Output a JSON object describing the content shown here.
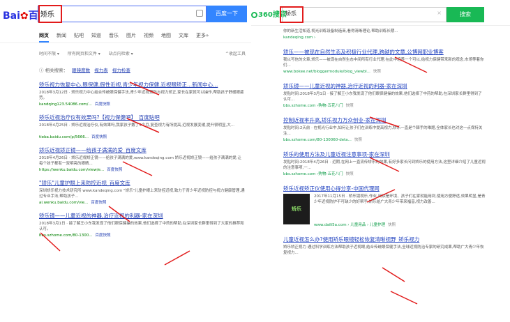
{
  "baidu": {
    "logo": {
      "brand_pre": "Bai",
      "brand_post": "百度"
    },
    "search": {
      "value": "矫乐",
      "button": "百度一下"
    },
    "tabs": [
      "网页",
      "新闻",
      "贴吧",
      "知道",
      "音乐",
      "图片",
      "视频",
      "地图",
      "文库",
      "更多»"
    ],
    "filters": {
      "time": "时间不限 ▾",
      "type": "所有网页和文件 ▾",
      "site": "站点内检索 ▾",
      "collapse": "^收起工具"
    },
    "related": {
      "label": "相关搜索：",
      "links": [
        "眼镜度数",
        "视力表",
        "视力检查"
      ]
    },
    "results": [
      {
        "title": "矫乐视力恢复中心,眼保健,假性近视,青少年视力保健,近视眼矫正...新闻中心...",
        "desc": "2018年3月12日 · 矫乐视力中心结合传统眼保健手法,青少年近视预防与视力矫正,家长在家就可以操作,帮助孩子舒缓眼疲劳。",
        "url": "kandqing123.54086.com/...",
        "snap": "百度快照"
      },
      {
        "title": "矫乐近视治疗仪有效果吗?【视力保健吧】_百度贴吧",
        "desc": "2018年4月25日 · 矫乐近视治疗仪,有效果吗,我家孩子戴了3个月,复查视力有所提高,近视发展变缓,提升很明显,大...",
        "url": "tieba.baidu.com/p/5666...",
        "snap": "百度快照"
      },
      {
        "title": "矫乐近视矫正镜——给孩子满满的爱_百度文库",
        "desc": "2018年4月26日 · 矫乐近视矫正镜——给孩子满满的爱,www.kandeqing.com 矫乐近视矫正镜——给孩子满满的爱,让每个孩子都有一双明亮的眼睛...",
        "url": "https://wenku.baidu.com/view/e...",
        "snap": "百度快照"
      },
      {
        "title": "\"矫乐\"儿童护眼上来防控近视_百度文库",
        "desc": "深圳矫乐视力技术研究所 www.kandeqing.com \"矫乐\"儿童护眼上来防控近视,致力于青少年近视防控与视力健康管理,通过专业手法,帮助孩子...",
        "url": "ai.wenku.baidu.com/vie...",
        "snap": "百度快照"
      },
      {
        "title": "矫乐镜——儿童近视的神器,治疗近视的利器-家在深圳",
        "desc": "2018年3月1日 · 接了解王小东我发现了他们眼保健操的效果,他们选择了中药的帮助,在深圳家长群里得到了大家的推荐和认可。",
        "url": "bbs.szhome.com/80-1300...",
        "snap": "百度快照"
      }
    ]
  },
  "so360": {
    "logo": {
      "brand": "360搜索"
    },
    "search": {
      "value": "矫乐",
      "clear": "×",
      "button": "搜索"
    },
    "results": [
      {
        "title": "",
        "desc": "你的新生活知道,视光训练设备制造商,看得清晰理论,帮助训练长期...",
        "url": "kandeqing.com ›",
        "snap": ""
      },
      {
        "title": "矫乐——被现在自然生态及积极行业代理,跨越的文章,公博网职业博客",
        "desc": "我以写信的文章,矫乐——被现在自然生态中间所有行业代理,在此中培养一个可以,给视力保健带来新的观念,市场等着你们...",
        "url": "www.bokee.net/bloggermodule/blog_viewbl...",
        "snap": "快照"
      },
      {
        "title": "矫乐镜——儿童近视的神器,治疗近视的利器-家在深圳",
        "desc": "发贴时间:2018年3月1日 · 接了解王小东我发现了他们眼保健操的效果,他们选择了中药的帮助,在深圳家长群里得到了认可...",
        "url": "bbs.szhome.com ›购物›五花八门",
        "snap": "快照"
      },
      {
        "title": "控制近视率升高,矫乐视力万众创业-家在深圳",
        "desc": "发贴时间:2天前 · 在视光行业中,如何让孩子们在训练中提高视力,矫乐一直是个棘手的难题,全体家长也对这一点保持关注...",
        "url": "bbs.szhome.com/80-130060-deta...",
        "snap": "快照"
      },
      {
        "title": "矫乐的使用方法及儿童近视注意事项-家在深圳",
        "desc": "发贴时间:2018年4月26日 · 近期,在网上一直流传矫乐的效果,有好多家长问到矫乐的使用方法,这里详细介绍了儿童近视的注意事项,一...",
        "url": "bbs.szhome.com ›购物›五花八门",
        "snap": "快照"
      },
      {
        "title": "矫乐近视矫正仪使用心得分享-中国代理网",
        "desc": "2017年11月15日 · 矫乐镜视乐,作业,阅读是环境、孩子们在家就能用到,使用方便舒适,效果明显,是青少年近视防护不可缺少的好帮手,矫乐给广大青少年带来福音,视力改善...",
        "url": "www.daili5a.com › 儿童用品 › 儿童护理",
        "snap": "快照",
        "thumb": "矫乐"
      },
      {
        "title": "儿童近视怎么办?使用矫乐眼镜轻松恢复清晰视野_矫乐视力",
        "desc": "矫乐矫正视力 通过科学训练方法帮助孩子近视眼,结合传统眼保健手法,全球近视防治专家的研究成果,帮助广大青少年恢复视力...",
        "url": "",
        "snap": ""
      }
    ]
  }
}
